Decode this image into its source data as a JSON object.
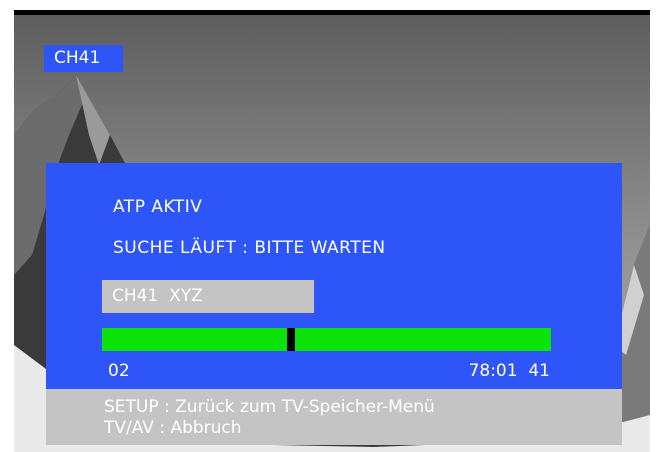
{
  "channel_badge": "CH41",
  "status": {
    "line1": "ATP AKTIV",
    "line2": "SUCHE LÄUFT : BITTE WARTEN"
  },
  "station_name": "CH41  XYZ",
  "progress": {
    "fraction": 0.42,
    "start_channel": "02",
    "end_info": "78:01  41"
  },
  "footer": {
    "line1": "SETUP : Zurück zum TV-Speicher-Menü",
    "line2": "TV/AV : Abbruch"
  },
  "colors": {
    "panel": "#2e55f7",
    "progress_bar": "#0be30b",
    "name_box": "#c4c4c4"
  }
}
